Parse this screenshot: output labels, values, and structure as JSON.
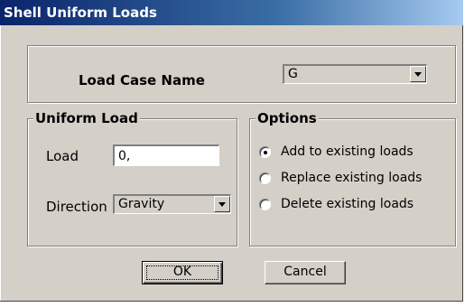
{
  "window": {
    "title": "Shell Uniform Loads"
  },
  "load_case": {
    "label": "Load Case Name",
    "selected": "G"
  },
  "uniform_load": {
    "legend": "Uniform Load",
    "load_label": "Load",
    "load_value": "0,",
    "direction_label": "Direction",
    "direction_selected": "Gravity"
  },
  "options": {
    "legend": "Options",
    "items": [
      {
        "label": "Add to existing loads",
        "selected": true
      },
      {
        "label": "Replace existing loads",
        "selected": false
      },
      {
        "label": "Delete existing loads",
        "selected": false
      }
    ]
  },
  "buttons": {
    "ok": "OK",
    "cancel": "Cancel"
  },
  "colors": {
    "face": "#d4d0c8",
    "title_start": "#0a246a",
    "title_end": "#a6caf0"
  }
}
